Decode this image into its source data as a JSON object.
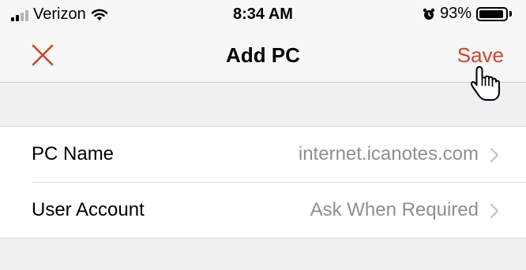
{
  "status_bar": {
    "carrier": "Verizon",
    "time": "8:34 AM",
    "battery": "93%",
    "battery_level": 0.93,
    "icons": [
      "signal-icon",
      "wifi-icon",
      "alarm-clock-icon",
      "battery-icon"
    ]
  },
  "nav": {
    "title": "Add PC",
    "save_label": "Save",
    "close_icon": "close-icon"
  },
  "settings": {
    "rows": [
      {
        "label": "PC Name",
        "value": "internet.icanotes.com"
      },
      {
        "label": "User Account",
        "value": "Ask When Required"
      }
    ]
  },
  "colors": {
    "accent": "#c8472e",
    "background": "#efeff4",
    "secondary_text": "#8e8e93"
  }
}
